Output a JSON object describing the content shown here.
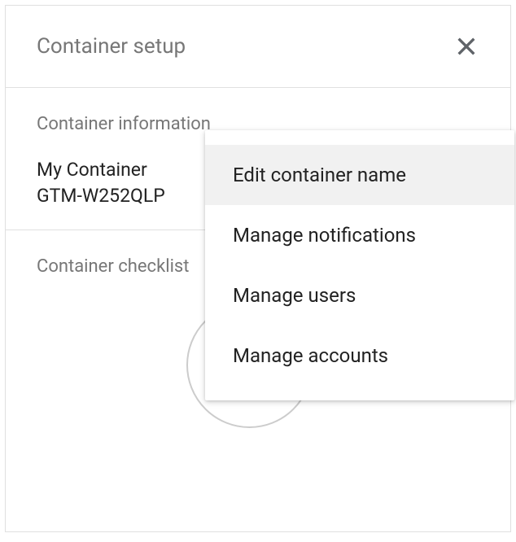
{
  "header": {
    "title": "Container setup"
  },
  "info_section": {
    "label": "Container information",
    "container_name": "My Container",
    "container_id": "GTM-W252QLP"
  },
  "checklist_section": {
    "label": "Container checklist"
  },
  "menu": {
    "items": [
      {
        "label": "Edit container name",
        "highlighted": true
      },
      {
        "label": "Manage notifications",
        "highlighted": false
      },
      {
        "label": "Manage users",
        "highlighted": false
      },
      {
        "label": "Manage accounts",
        "highlighted": false
      }
    ]
  }
}
